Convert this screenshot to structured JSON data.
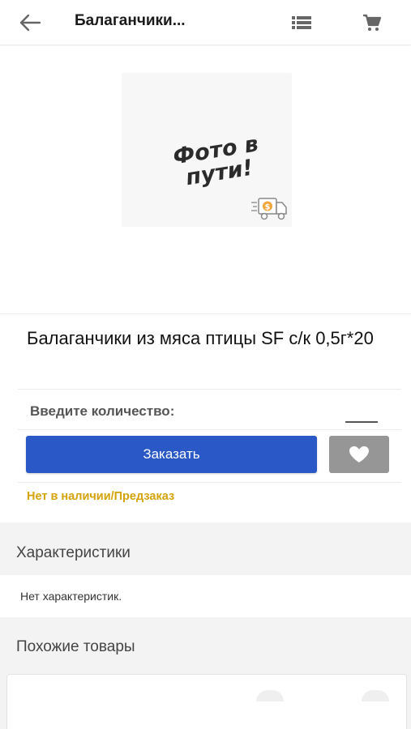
{
  "header": {
    "title": "Балаганчики...",
    "back_icon": "arrow-left-icon",
    "list_icon": "list-icon",
    "cart_icon": "cart-icon"
  },
  "image": {
    "placeholder_text_line1": "Фото в",
    "placeholder_text_line2": "пути!",
    "truck_badge": "$"
  },
  "product": {
    "title": "Балаганчики из мяса птицы  SF с/к 0,5г*20",
    "quantity_label": "Введите количество:",
    "quantity_value": "",
    "order_button": "Заказать",
    "favorite_icon": "heart-icon",
    "stock_status": "Нет в наличии/Предзаказ"
  },
  "characteristics": {
    "heading": "Характеристики",
    "text": "Нет характеристик."
  },
  "similar": {
    "heading": "Похожие товары"
  },
  "colors": {
    "primary": "#2a59c7",
    "favorite_bg": "#969696",
    "status": "#d4a20a"
  }
}
